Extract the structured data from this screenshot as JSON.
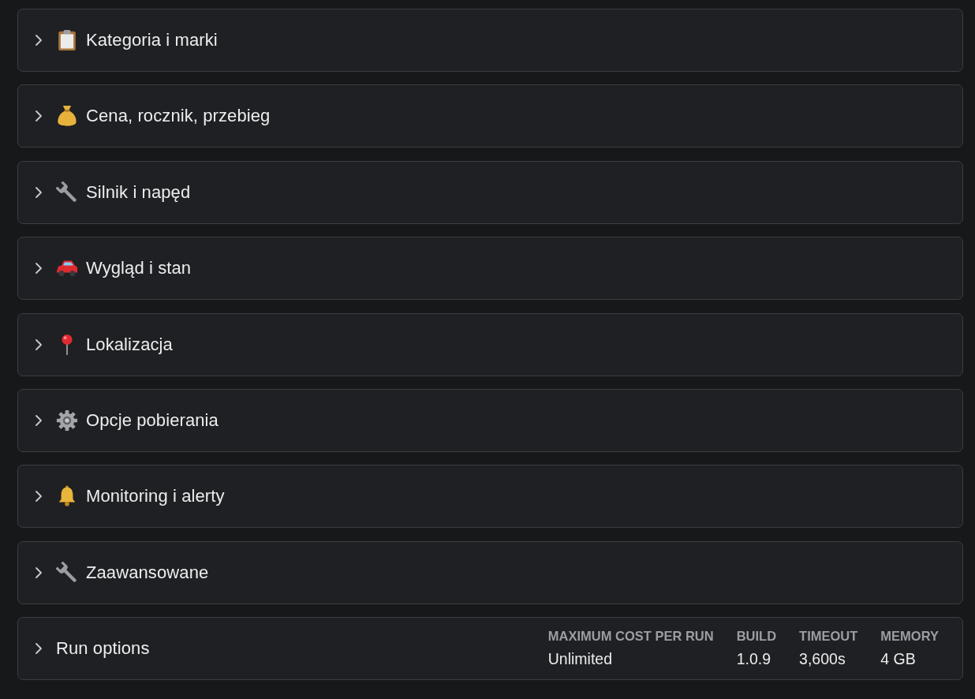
{
  "sections": [
    {
      "title": "Kategoria i marki",
      "expanded": false
    },
    {
      "title": "Cena, rocznik, przebieg",
      "expanded": false
    },
    {
      "title": "Silnik i napęd",
      "expanded": false
    },
    {
      "title": "Wygląd i stan",
      "expanded": false
    },
    {
      "title": "Lokalizacja",
      "expanded": false
    },
    {
      "title": "Opcje pobierania",
      "expanded": false
    },
    {
      "title": "Monitoring i alerty",
      "expanded": false
    },
    {
      "title": "Zaawansowane",
      "expanded": false
    }
  ],
  "run_options": {
    "title": "Run options",
    "expanded": false,
    "stats": [
      {
        "label": "MAXIMUM COST PER RUN",
        "value": "Unlimited"
      },
      {
        "label": "BUILD",
        "value": "1.0.9"
      },
      {
        "label": "TIMEOUT",
        "value": "3,600s"
      },
      {
        "label": "MEMORY",
        "value": "4 GB"
      }
    ]
  }
}
